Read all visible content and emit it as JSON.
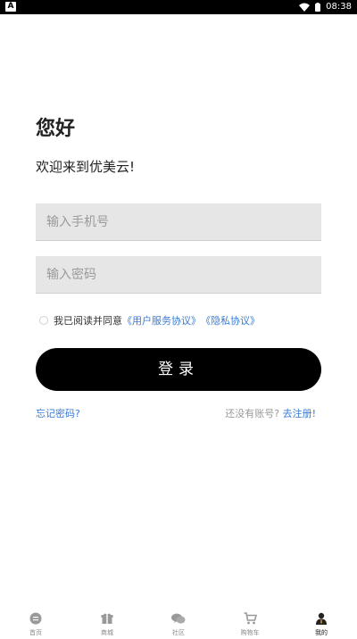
{
  "status_bar": {
    "app_badge": "A",
    "time": "08:38"
  },
  "greeting": "您好",
  "welcome": "欢迎来到优美云!",
  "form": {
    "phone_placeholder": "输入手机号",
    "password_placeholder": "输入密码"
  },
  "agreement": {
    "prefix": "我已阅读并同意",
    "user_agreement": "《用户服务协议》",
    "privacy_agreement": "《隐私协议》"
  },
  "login_button": "登录",
  "forgot_password": "忘记密码?",
  "register": {
    "prompt": "还没有账号?",
    "link": "去注册!"
  },
  "tabs": [
    {
      "label": "首页",
      "icon": "home-icon"
    },
    {
      "label": "商城",
      "icon": "gift-icon"
    },
    {
      "label": "社区",
      "icon": "community-icon"
    },
    {
      "label": "购物车",
      "icon": "cart-icon"
    },
    {
      "label": "我的",
      "icon": "profile-icon"
    }
  ],
  "colors": {
    "link": "#3a7bd5",
    "button": "#000000",
    "field_bg": "#e6e6e6"
  }
}
